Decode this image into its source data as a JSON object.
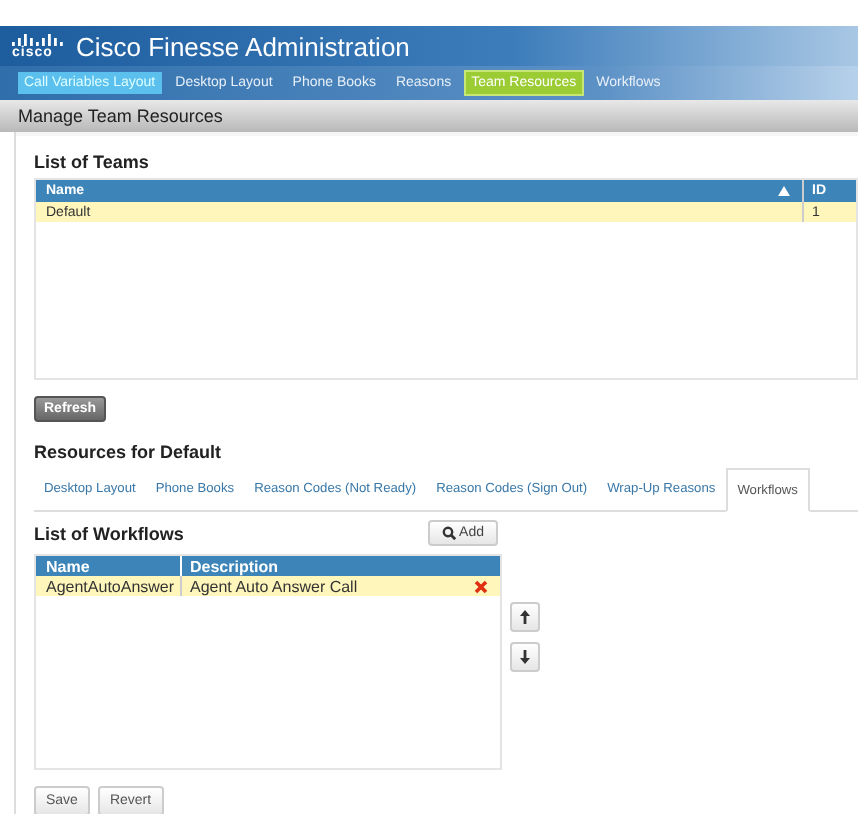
{
  "header": {
    "logo_text": "cisco",
    "title": "Cisco Finesse Administration"
  },
  "nav": [
    {
      "label": "Call Variables Layout",
      "selected": false,
      "hovered": true
    },
    {
      "label": "Desktop Layout",
      "selected": false,
      "hovered": false
    },
    {
      "label": "Phone Books",
      "selected": false,
      "hovered": false
    },
    {
      "label": "Reasons",
      "selected": false,
      "hovered": false
    },
    {
      "label": "Team Resources",
      "selected": true,
      "hovered": false
    },
    {
      "label": "Workflows",
      "selected": false,
      "hovered": false
    }
  ],
  "page_title": "Manage Team Resources",
  "teams": {
    "title": "List of Teams",
    "columns": [
      {
        "label": "Name",
        "sorted": true
      },
      {
        "label": "ID",
        "sorted": false
      }
    ],
    "rows": [
      {
        "cells": [
          "Default",
          "1"
        ],
        "selected": true
      }
    ],
    "refresh_button": "Refresh"
  },
  "resources": {
    "title": "Resources for Default",
    "tabs": [
      {
        "label": "Desktop Layout",
        "selected": false
      },
      {
        "label": "Phone Books",
        "selected": false
      },
      {
        "label": "Reason Codes (Not Ready)",
        "selected": false
      },
      {
        "label": "Reason Codes (Sign Out)",
        "selected": false
      },
      {
        "label": "Wrap-Up Reasons",
        "selected": false
      },
      {
        "label": "Workflows",
        "selected": true
      }
    ],
    "list_title": "List of Workflows",
    "add_button": "Add",
    "columns": [
      "Name",
      "Description"
    ],
    "rows": [
      {
        "cells": [
          "AgentAutoAnswer",
          "Agent Auto Answer Call"
        ],
        "selected": true
      }
    ],
    "buttons": [
      "Save",
      "Revert"
    ]
  }
}
